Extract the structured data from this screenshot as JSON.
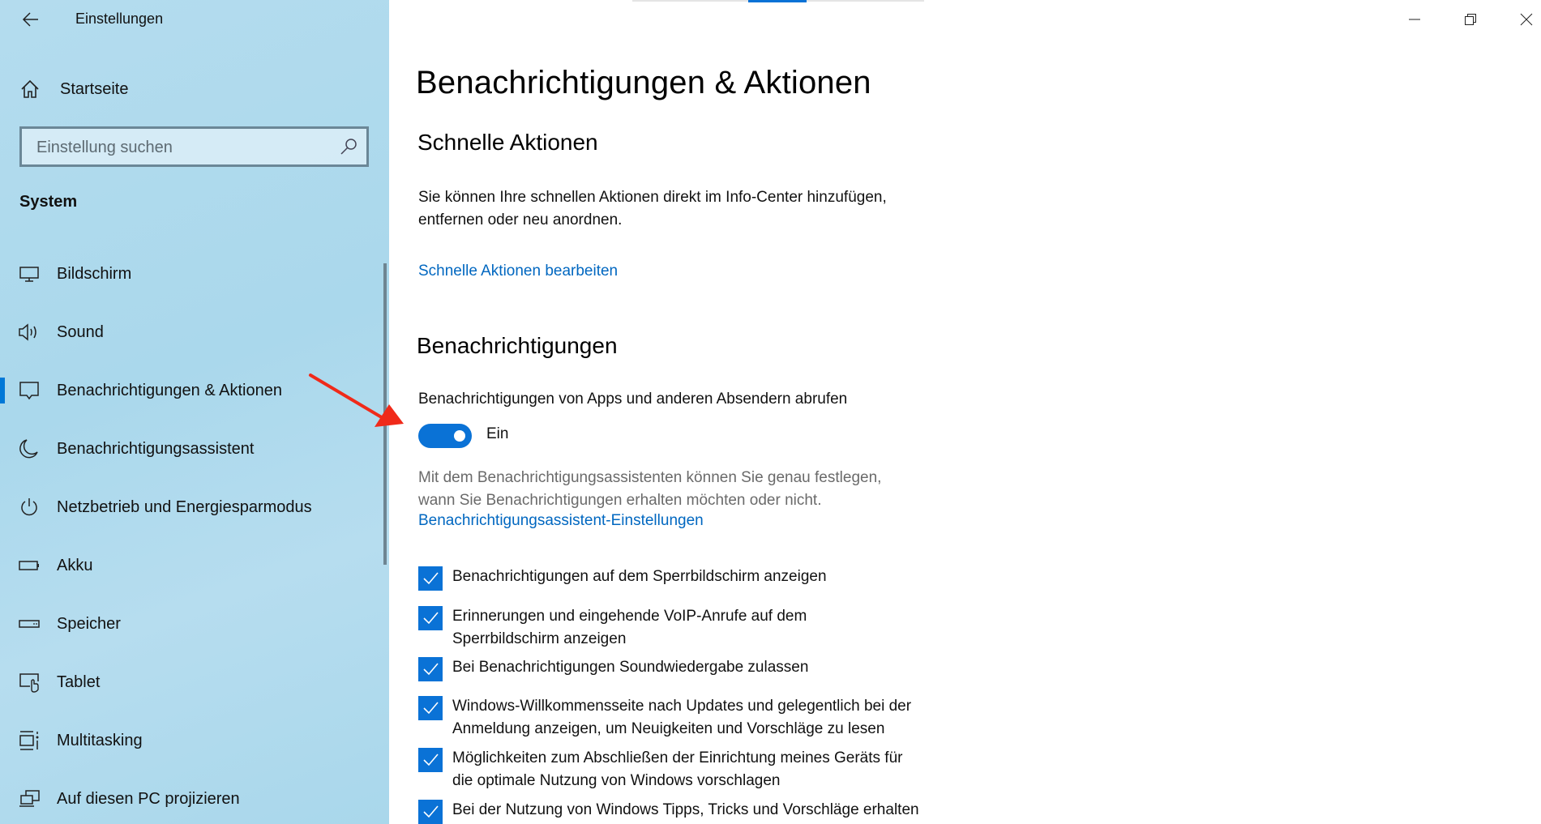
{
  "window": {
    "title": "Einstellungen",
    "controls": {
      "minimize": "minimize-icon",
      "restore": "restore-icon",
      "close": "close-icon"
    }
  },
  "sidebar": {
    "back_icon": "arrow-left-icon",
    "home": {
      "label": "Startseite",
      "icon": "home-icon"
    },
    "search": {
      "placeholder": "Einstellung suchen",
      "value": "",
      "icon": "search-icon"
    },
    "section": "System",
    "items": [
      {
        "label": "Bildschirm",
        "icon": "monitor-icon",
        "selected": false
      },
      {
        "label": "Sound",
        "icon": "speaker-icon",
        "selected": false
      },
      {
        "label": "Benachrichtigungen & Aktionen",
        "icon": "message-icon",
        "selected": true
      },
      {
        "label": "Benachrichtigungsassistent",
        "icon": "moon-icon",
        "selected": false
      },
      {
        "label": "Netzbetrieb und Energiesparmodus",
        "icon": "power-icon",
        "selected": false
      },
      {
        "label": "Akku",
        "icon": "battery-icon",
        "selected": false
      },
      {
        "label": "Speicher",
        "icon": "storage-icon",
        "selected": false
      },
      {
        "label": "Tablet",
        "icon": "tablet-icon",
        "selected": false
      },
      {
        "label": "Multitasking",
        "icon": "multitasking-icon",
        "selected": false
      },
      {
        "label": "Auf diesen PC projizieren",
        "icon": "project-icon",
        "selected": false
      }
    ]
  },
  "main": {
    "title": "Benachrichtigungen & Aktionen",
    "quick_actions": {
      "heading": "Schnelle Aktionen",
      "description_line1": "Sie können Ihre schnellen Aktionen direkt im Info-Center hinzufügen,",
      "description_line2": "entfernen oder neu anordnen.",
      "link": "Schnelle Aktionen bearbeiten"
    },
    "notifications": {
      "heading": "Benachrichtigungen",
      "toggle_label": "Benachrichtigungen von Apps und anderen Absendern abrufen",
      "toggle_state": "Ein",
      "toggle_on": true,
      "assistant_text_line1": "Mit dem Benachrichtigungsassistenten können Sie genau festlegen,",
      "assistant_text_line2": "wann Sie Benachrichtigungen erhalten möchten oder nicht.",
      "assistant_link": "Benachrichtigungsassistent-Einstellungen",
      "checkboxes": [
        {
          "label_line1": "Benachrichtigungen auf dem Sperrbildschirm anzeigen",
          "label_line2": "",
          "checked": true
        },
        {
          "label_line1": "Erinnerungen und eingehende VoIP-Anrufe auf dem",
          "label_line2": "Sperrbildschirm anzeigen",
          "checked": true
        },
        {
          "label_line1": "Bei Benachrichtigungen Soundwiedergabe zulassen",
          "label_line2": "",
          "checked": true
        },
        {
          "label_line1": "Windows-Willkommensseite nach Updates und gelegentlich bei der",
          "label_line2": "Anmeldung anzeigen, um Neuigkeiten und Vorschläge zu lesen",
          "checked": true
        },
        {
          "label_line1": "Möglichkeiten zum Abschließen der Einrichtung meines Geräts für",
          "label_line2": "die optimale Nutzung von Windows vorschlagen",
          "checked": true
        },
        {
          "label_line1": "Bei der Nutzung von Windows Tipps, Tricks und Vorschläge erhalten",
          "label_line2": "",
          "checked": true
        }
      ]
    }
  },
  "colors": {
    "accent": "#0a72d6",
    "link": "#0067c0",
    "sidebar_bg": "#aed9ed",
    "annotation_arrow": "#f02a1a"
  }
}
